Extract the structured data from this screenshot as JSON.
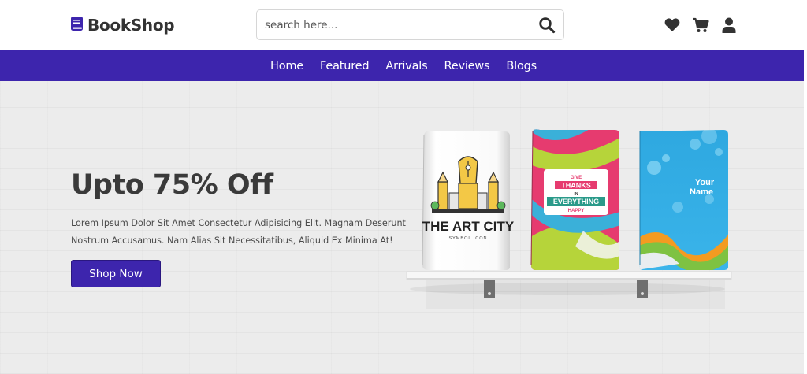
{
  "header": {
    "logo_text": "BookShop",
    "search": {
      "placeholder": "search here..."
    },
    "icons": [
      "heart-icon",
      "cart-icon",
      "user-icon"
    ]
  },
  "nav": {
    "items": [
      {
        "label": "Home"
      },
      {
        "label": "Featured"
      },
      {
        "label": "Arrivals"
      },
      {
        "label": "Reviews"
      },
      {
        "label": "Blogs"
      }
    ]
  },
  "hero": {
    "title": "Upto 75% Off",
    "description": "Lorem Ipsum Dolor Sit Amet Consectetur Adipisicing Elit. Magnam Deserunt Nostrum Accusamus. Nam Alias Sit Necessitatibus, Aliquid Ex Minima At!",
    "button_label": "Shop Now",
    "books": [
      {
        "title_line1": "THE ART CITY",
        "subtitle": "SYMBOL ICON"
      },
      {
        "text_give": "GIVE",
        "text_thanks": "THANKS",
        "text_in": "IN",
        "text_everything": "EVERYTHING",
        "text_happy": "HAPPY"
      },
      {
        "line1": "Your",
        "line2": "Name"
      }
    ]
  },
  "colors": {
    "brand": "#3d25ad",
    "heading": "#3a3a3a",
    "hero_bg": "#ececec"
  }
}
